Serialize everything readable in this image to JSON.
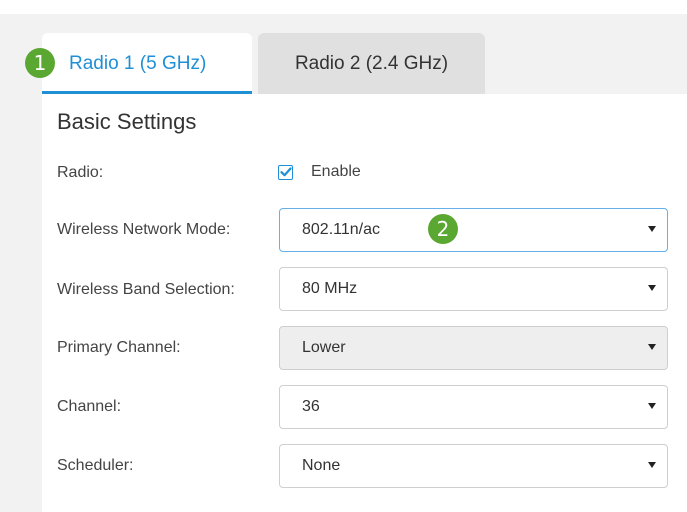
{
  "tabs": [
    {
      "label": "Radio 1 (5 GHz)",
      "active": true,
      "badge": "1"
    },
    {
      "label": "Radio 2 (2.4 GHz)",
      "active": false
    }
  ],
  "section": {
    "title": "Basic Settings"
  },
  "radio": {
    "label": "Radio:",
    "checkbox_label": "Enable",
    "checked": true
  },
  "fields": {
    "wireless_network_mode": {
      "label": "Wireless Network Mode:",
      "value": "802.11n/ac",
      "badge": "2"
    },
    "wireless_band_selection": {
      "label": "Wireless Band Selection:",
      "value": "80 MHz"
    },
    "primary_channel": {
      "label": "Primary Channel:",
      "value": "Lower",
      "disabled": true
    },
    "channel": {
      "label": "Channel:",
      "value": "36"
    },
    "scheduler": {
      "label": "Scheduler:",
      "value": "None"
    }
  },
  "colors": {
    "accent": "#1f8fd6",
    "badge": "#5aa832",
    "focus_border": "#66afe9"
  },
  "icons": {
    "checkbox": "checkmark-icon",
    "select_arrow": "caret-down-icon"
  }
}
